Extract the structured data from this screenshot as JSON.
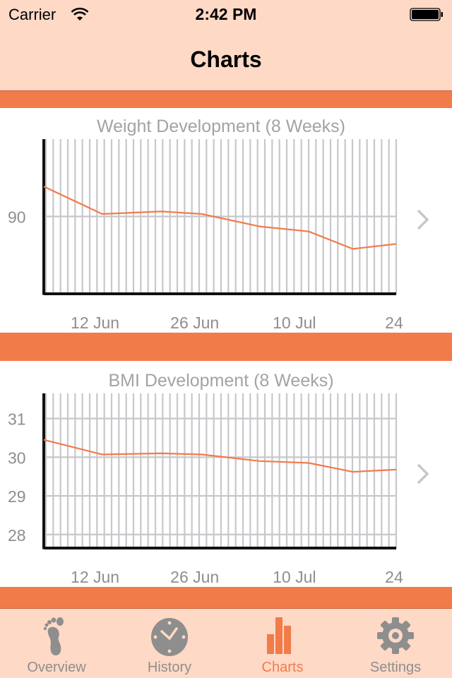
{
  "status_bar": {
    "carrier": "Carrier",
    "time": "2:42 PM",
    "wifi_icon": "wifi-icon",
    "battery_icon": "battery-full-icon"
  },
  "nav": {
    "title": "Charts"
  },
  "colors": {
    "accent": "#f27b4a",
    "header_bg": "#fed9c6",
    "grid": "#c8c8cc",
    "axis": "#111111",
    "label": "#8e8e8e"
  },
  "chart_data": [
    {
      "type": "line",
      "title": "Weight Development (8 Weeks)",
      "xlabel": "",
      "ylabel": "",
      "x_ticks": [
        {
          "label": "12 Jun",
          "day": 7
        },
        {
          "label": "26 Jun",
          "day": 21
        },
        {
          "label": "10 Jul",
          "day": 35
        },
        {
          "label": "24",
          "day": 49
        }
      ],
      "y_ticks": [
        90
      ],
      "xlim": [
        0,
        49.5
      ],
      "ylim": [
        86.9,
        93.1
      ],
      "grid": true,
      "series": [
        {
          "name": "Weight",
          "x": [
            0,
            8.2,
            16.5,
            22.2,
            30.3,
            37.2,
            43.4,
            49.5
          ],
          "values": [
            91.2,
            90.1,
            90.2,
            90.1,
            89.6,
            89.4,
            88.7,
            88.9
          ]
        }
      ]
    },
    {
      "type": "line",
      "title": "BMI Development (8 Weeks)",
      "xlabel": "",
      "ylabel": "",
      "x_ticks": [
        {
          "label": "12 Jun",
          "day": 7
        },
        {
          "label": "26 Jun",
          "day": 21
        },
        {
          "label": "10 Jul",
          "day": 35
        },
        {
          "label": "24",
          "day": 49
        }
      ],
      "y_ticks": [
        28,
        29,
        30,
        31
      ],
      "xlim": [
        0,
        49.5
      ],
      "ylim": [
        27.65,
        31.65
      ],
      "grid": true,
      "series": [
        {
          "name": "BMI",
          "x": [
            0,
            8.2,
            16.5,
            22.2,
            30.3,
            37.2,
            43.4,
            49.5
          ],
          "values": [
            30.45,
            30.07,
            30.1,
            30.07,
            29.9,
            29.85,
            29.62,
            29.68
          ]
        }
      ]
    }
  ],
  "detail_chevron_icon": "chevron-right-icon",
  "tabs": [
    {
      "label": "Overview",
      "icon": "footprint-icon",
      "active": false
    },
    {
      "label": "History",
      "icon": "clock-icon",
      "active": false
    },
    {
      "label": "Charts",
      "icon": "bar-chart-icon",
      "active": true
    },
    {
      "label": "Settings",
      "icon": "gear-icon",
      "active": false
    }
  ]
}
